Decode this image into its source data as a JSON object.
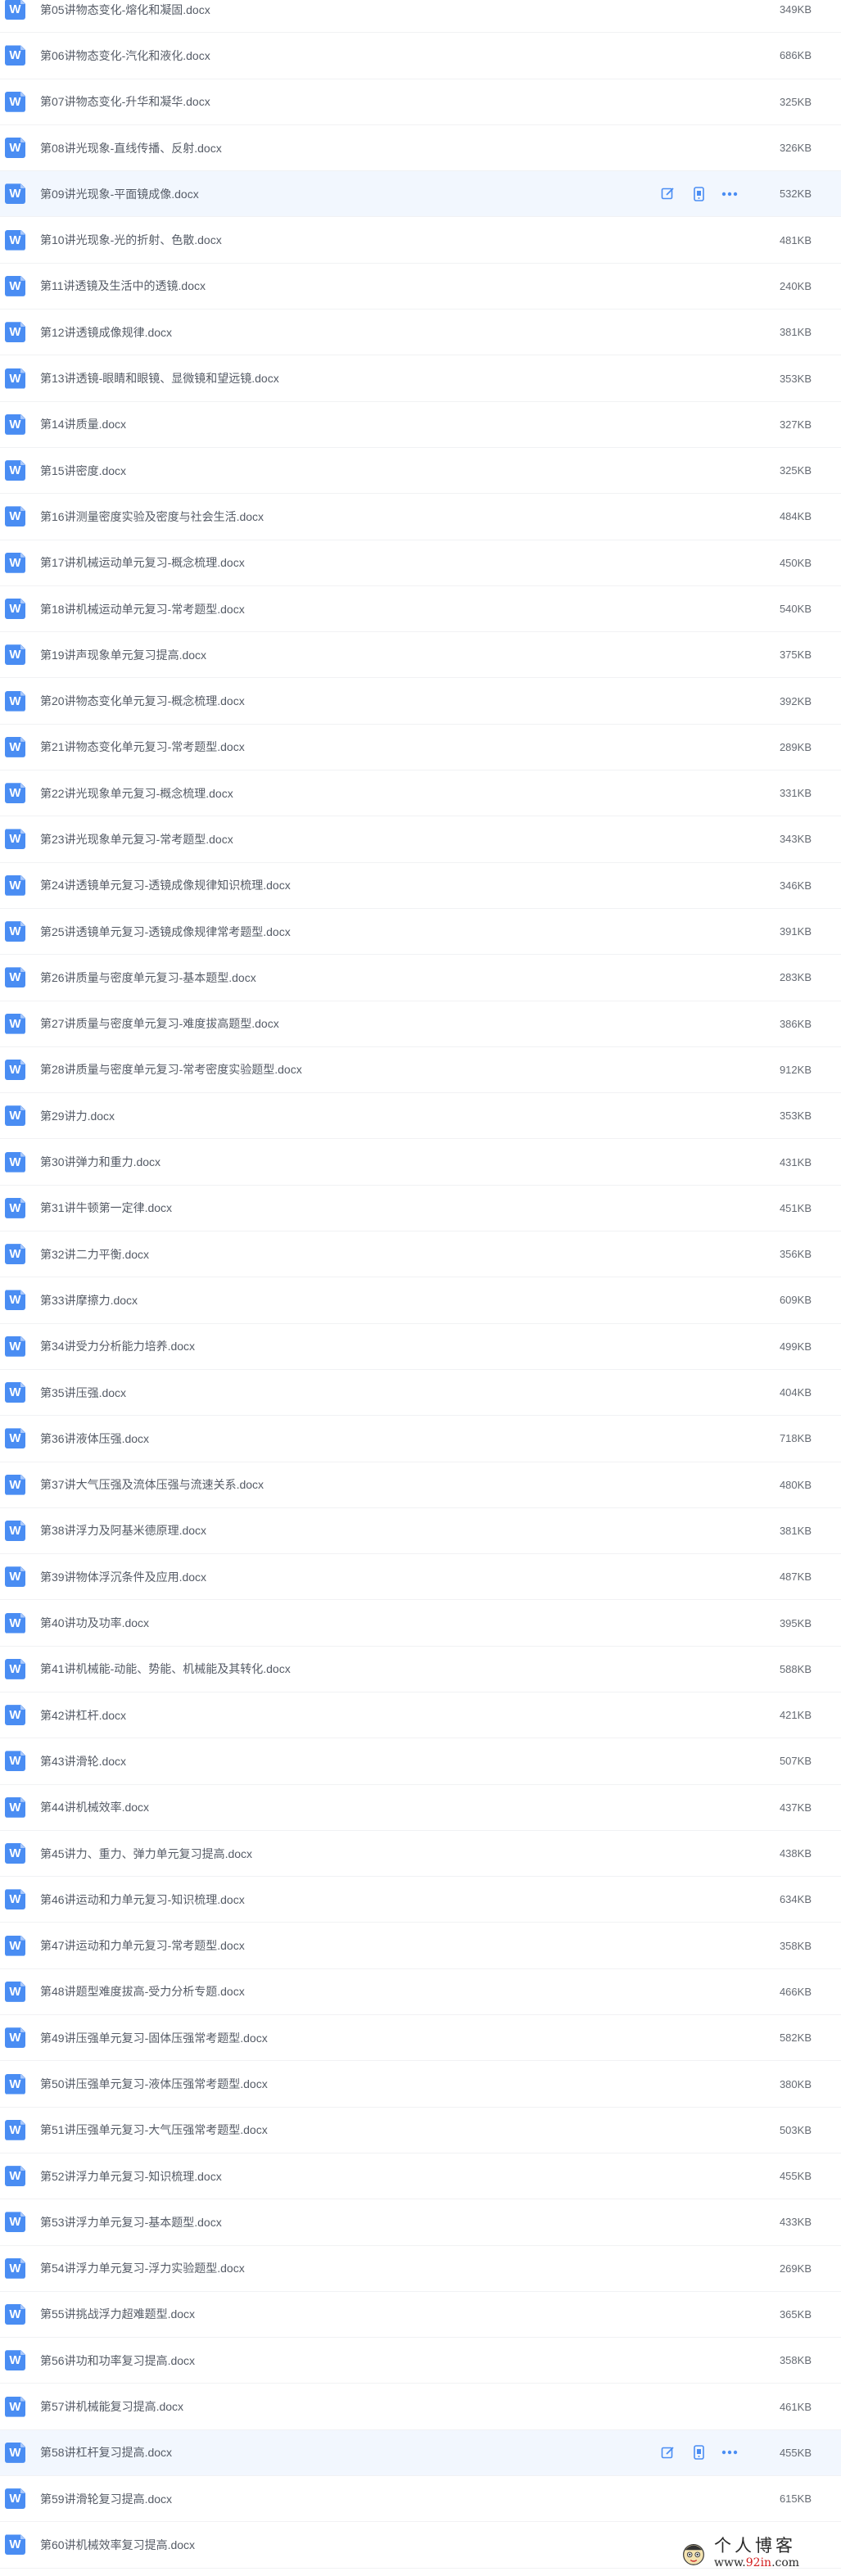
{
  "colors": {
    "accent": "#4a8df3",
    "row_highlight": "#f2f7fe",
    "text": "#555b66"
  },
  "icons": {
    "file": "word-doc-icon",
    "edit": "edit-icon",
    "mobile": "mobile-phone-icon",
    "more": "more-icon"
  },
  "files": [
    {
      "name": "第05讲物态变化-熔化和凝固.docx",
      "size": "349KB"
    },
    {
      "name": "第06讲物态变化-汽化和液化.docx",
      "size": "686KB"
    },
    {
      "name": "第07讲物态变化-升华和凝华.docx",
      "size": "325KB"
    },
    {
      "name": "第08讲光现象-直线传播、反射.docx",
      "size": "326KB"
    },
    {
      "name": "第09讲光现象-平面镜成像.docx",
      "size": "532KB",
      "hovered": true
    },
    {
      "name": "第10讲光现象-光的折射、色散.docx",
      "size": "481KB"
    },
    {
      "name": "第11讲透镜及生活中的透镜.docx",
      "size": "240KB"
    },
    {
      "name": "第12讲透镜成像规律.docx",
      "size": "381KB"
    },
    {
      "name": "第13讲透镜-眼睛和眼镜、显微镜和望远镜.docx",
      "size": "353KB"
    },
    {
      "name": "第14讲质量.docx",
      "size": "327KB"
    },
    {
      "name": "第15讲密度.docx",
      "size": "325KB"
    },
    {
      "name": "第16讲测量密度实验及密度与社会生活.docx",
      "size": "484KB"
    },
    {
      "name": "第17讲机械运动单元复习-概念梳理.docx",
      "size": "450KB"
    },
    {
      "name": "第18讲机械运动单元复习-常考题型.docx",
      "size": "540KB"
    },
    {
      "name": "第19讲声现象单元复习提高.docx",
      "size": "375KB"
    },
    {
      "name": "第20讲物态变化单元复习-概念梳理.docx",
      "size": "392KB"
    },
    {
      "name": "第21讲物态变化单元复习-常考题型.docx",
      "size": "289KB"
    },
    {
      "name": "第22讲光现象单元复习-概念梳理.docx",
      "size": "331KB"
    },
    {
      "name": "第23讲光现象单元复习-常考题型.docx",
      "size": "343KB"
    },
    {
      "name": "第24讲透镜单元复习-透镜成像规律知识梳理.docx",
      "size": "346KB"
    },
    {
      "name": "第25讲透镜单元复习-透镜成像规律常考题型.docx",
      "size": "391KB"
    },
    {
      "name": "第26讲质量与密度单元复习-基本题型.docx",
      "size": "283KB"
    },
    {
      "name": "第27讲质量与密度单元复习-难度拔高题型.docx",
      "size": "386KB"
    },
    {
      "name": "第28讲质量与密度单元复习-常考密度实验题型.docx",
      "size": "912KB"
    },
    {
      "name": "第29讲力.docx",
      "size": "353KB"
    },
    {
      "name": "第30讲弹力和重力.docx",
      "size": "431KB"
    },
    {
      "name": "第31讲牛顿第一定律.docx",
      "size": "451KB"
    },
    {
      "name": "第32讲二力平衡.docx",
      "size": "356KB"
    },
    {
      "name": "第33讲摩擦力.docx",
      "size": "609KB"
    },
    {
      "name": "第34讲受力分析能力培养.docx",
      "size": "499KB"
    },
    {
      "name": "第35讲压强.docx",
      "size": "404KB"
    },
    {
      "name": "第36讲液体压强.docx",
      "size": "718KB"
    },
    {
      "name": "第37讲大气压强及流体压强与流速关系.docx",
      "size": "480KB"
    },
    {
      "name": "第38讲浮力及阿基米德原理.docx",
      "size": "381KB"
    },
    {
      "name": "第39讲物体浮沉条件及应用.docx",
      "size": "487KB"
    },
    {
      "name": "第40讲功及功率.docx",
      "size": "395KB"
    },
    {
      "name": "第41讲机械能-动能、势能、机械能及其转化.docx",
      "size": "588KB"
    },
    {
      "name": "第42讲杠杆.docx",
      "size": "421KB"
    },
    {
      "name": "第43讲滑轮.docx",
      "size": "507KB"
    },
    {
      "name": "第44讲机械效率.docx",
      "size": "437KB"
    },
    {
      "name": "第45讲力、重力、弹力单元复习提高.docx",
      "size": "438KB"
    },
    {
      "name": "第46讲运动和力单元复习-知识梳理.docx",
      "size": "634KB"
    },
    {
      "name": "第47讲运动和力单元复习-常考题型.docx",
      "size": "358KB"
    },
    {
      "name": "第48讲题型难度拔高-受力分析专题.docx",
      "size": "466KB"
    },
    {
      "name": "第49讲压强单元复习-固体压强常考题型.docx",
      "size": "582KB"
    },
    {
      "name": "第50讲压强单元复习-液体压强常考题型.docx",
      "size": "380KB"
    },
    {
      "name": "第51讲压强单元复习-大气压强常考题型.docx",
      "size": "503KB"
    },
    {
      "name": "第52讲浮力单元复习-知识梳理.docx",
      "size": "455KB"
    },
    {
      "name": "第53讲浮力单元复习-基本题型.docx",
      "size": "433KB"
    },
    {
      "name": "第54讲浮力单元复习-浮力实验题型.docx",
      "size": "269KB"
    },
    {
      "name": "第55讲挑战浮力超难题型.docx",
      "size": "365KB"
    },
    {
      "name": "第56讲功和功率复习提高.docx",
      "size": "358KB"
    },
    {
      "name": "第57讲机械能复习提高.docx",
      "size": "461KB"
    },
    {
      "name": "第58讲杠杆复习提高.docx",
      "size": "455KB",
      "hovered": true
    },
    {
      "name": "第59讲滑轮复习提高.docx",
      "size": "615KB"
    },
    {
      "name": "第60讲机械效率复习提高.docx",
      "size": ""
    }
  ],
  "watermark": {
    "title": "个人博客",
    "url_prefix": "www.",
    "url_highlight": "92in",
    "url_suffix": ".com"
  }
}
